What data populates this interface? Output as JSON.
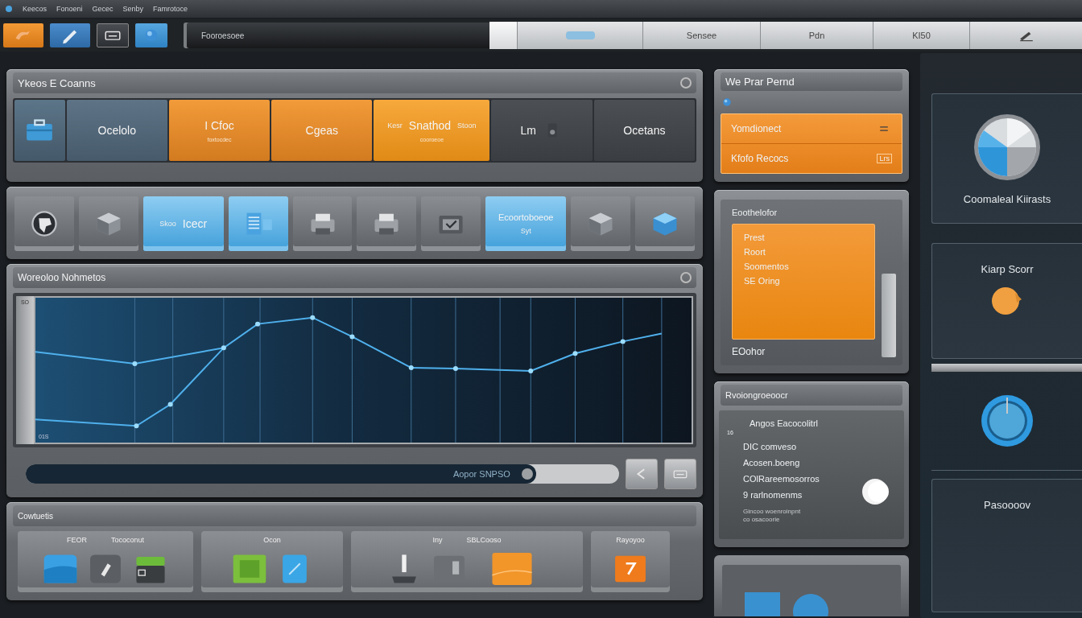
{
  "menu": [
    "Keecos",
    "Fonoeni",
    "Gecec",
    "Senby",
    "Famrotoce"
  ],
  "toolbar": {
    "field": "Fooroesoee",
    "segments": [
      "Sensee",
      "Pdn",
      "KI50"
    ]
  },
  "tiles_panel": {
    "title": "Ykeos E Coanns",
    "tiles": [
      {
        "kind": "icon"
      },
      {
        "kind": "slate",
        "label": "Ocelolo"
      },
      {
        "kind": "orange",
        "label": "I Cfoc",
        "sub": "foxtocdec"
      },
      {
        "kind": "orange",
        "label": "Cgeas"
      },
      {
        "kind": "bright",
        "pre": "Kesr",
        "label": "Snathod",
        "post": "Stoon",
        "sub": "cooroeoe"
      },
      {
        "kind": "dark",
        "label": "Lm"
      },
      {
        "kind": "dark",
        "label": "Ocetans"
      }
    ]
  },
  "icon_row": [
    {
      "selected": false
    },
    {
      "selected": false
    },
    {
      "selected": true,
      "pre": "Skoo",
      "label": "Icecr"
    },
    {
      "selected": true
    },
    {
      "selected": false
    },
    {
      "selected": false
    },
    {
      "selected": false
    },
    {
      "selected": true,
      "label": "Ecoortoboeoe",
      "sub": "Syt"
    },
    {
      "selected": false
    },
    {
      "selected": false
    }
  ],
  "monitor": {
    "title": "Woreoloo Nohmetos",
    "side_label": "SO",
    "corner_label": "01S",
    "progress": {
      "level": 0.86,
      "label": "Aopor SNPSO"
    }
  },
  "contents": {
    "title": "Cowtuetis",
    "groups": [
      {
        "labels": [
          "FEOR",
          "Tococonut"
        ]
      },
      {
        "labels": [
          "Ocon"
        ]
      },
      {
        "labels": [
          "Iny",
          "SBLCooso"
        ]
      },
      {
        "labels": [
          "Rayoyoo"
        ]
      }
    ]
  },
  "profile": {
    "title": "We Prar Pernd",
    "rows": [
      {
        "label": "Yomdionect"
      },
      {
        "label": "Kfofo Recocs",
        "badge": "Lrs"
      }
    ]
  },
  "editor": {
    "title": "Eoothelofor",
    "lines": [
      "Prest",
      "Roort",
      "Soomentos",
      "SE Oring"
    ],
    "footer": "EOohor"
  },
  "settings": {
    "title": "Rvoiongroeoocr",
    "heading": "Angos Eacocolitrl",
    "marker": "16",
    "lines": [
      "DIC comveso",
      "Acosen.boeng",
      "COlRareemosorros",
      "9 rarlnomenms"
    ],
    "note": [
      "Gincoo woenroinpnt",
      "co osacoorie"
    ]
  },
  "side": {
    "cards": [
      {
        "kind": "pie",
        "label": "Coomaleal Kiirasts"
      },
      {
        "kind": "knob",
        "label": "Kiarp Scorr"
      },
      {
        "kind": "power"
      },
      {
        "kind": "text",
        "label": "Pasoooov"
      }
    ]
  }
}
